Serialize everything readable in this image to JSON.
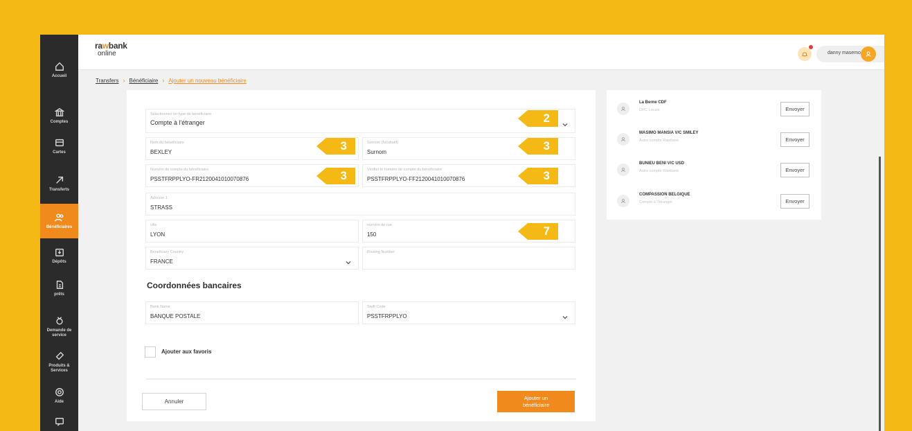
{
  "colors": {
    "accent": "#f08a1c",
    "badge": "#f5b915",
    "background": "#f5b915",
    "sidebar": "#2b2b2b"
  },
  "logo": {
    "part1a": "ra",
    "part1b": "w",
    "part1c": "bank",
    "part2": "online"
  },
  "header": {
    "user_name": "danny masemo"
  },
  "breadcrumb": {
    "item1": "Transfers",
    "item2": "Bénéficiaire",
    "item3": "Ajouter un nouveau bénéficiaire"
  },
  "sidebar": {
    "items": [
      {
        "label": "Accueil",
        "icon": "home-icon"
      },
      {
        "label": "Comptes",
        "icon": "bank-icon"
      },
      {
        "label": "Cartes",
        "icon": "card-icon"
      },
      {
        "label": "Transferts",
        "icon": "arrow-icon"
      },
      {
        "label": "Bénéficiaires",
        "icon": "users-icon"
      },
      {
        "label": "Dépôts",
        "icon": "deposit-icon"
      },
      {
        "label": "prêts",
        "icon": "loan-icon"
      },
      {
        "label": "Demande de service",
        "icon": "service-icon"
      },
      {
        "label": "Produits & Services",
        "icon": "tag-icon"
      },
      {
        "label": "Aide",
        "icon": "help-icon"
      },
      {
        "label": "",
        "icon": "chat-icon"
      }
    ]
  },
  "form": {
    "type": {
      "label": "Sélectionnez un type de bénéficiaire",
      "value": "Compte à l'étranger"
    },
    "name": {
      "label": "Nom du bénéficiaire",
      "value": "BEXLEY"
    },
    "surname": {
      "label": "Surnom (facultatif)",
      "value": "Surnom"
    },
    "account": {
      "label": "Numéro de compte du bénéficiaire",
      "value": "PSSTFRPPLYO-FR2120041010070876"
    },
    "account_verify": {
      "label": "Vérifier le numéro de compte du bénéficiaire",
      "value": "PSSTFRPPLYO-FF2120041010070876"
    },
    "address": {
      "label": "Adresse 1",
      "value": "STRASS"
    },
    "city": {
      "label": "ville",
      "value": "LYON"
    },
    "street_number": {
      "label": "numéro de rue",
      "value": "150"
    },
    "country": {
      "label": "Beneficiary Country",
      "value": "FRANCE"
    },
    "routing": {
      "label": "Routing Number",
      "value": ""
    },
    "bank_section_title": "Coordonnées bancaires",
    "bank_name": {
      "label": "Bank Name",
      "value": "BANQUE POSTALE"
    },
    "swift": {
      "label": "Swift Code",
      "value": "PSSTFRPPLYO"
    },
    "favorites_label": "Ajouter aux favoris",
    "cancel_label": "Annuler",
    "submit_label": "Ajouter un bénéficiaire"
  },
  "badges": {
    "type": "2",
    "name": "3",
    "surname": "3",
    "account": "3",
    "account_verify": "3",
    "street_number": "7"
  },
  "beneficiaries": [
    {
      "name": "La Berne CDF",
      "sub": "DRC Locale",
      "button": "Envoyer"
    },
    {
      "name": "MASIMO MANSIA V/C SMILEY",
      "sub": "Autre compte Rawbank",
      "button": "Envoyer"
    },
    {
      "name": "BUNIEU BENI V/C USD",
      "sub": "Autre compte Rawbank",
      "button": "Envoyer"
    },
    {
      "name": "COMPASSION BELGIQUE",
      "sub": "Compte à l'étranger",
      "button": "Envoyer"
    }
  ]
}
